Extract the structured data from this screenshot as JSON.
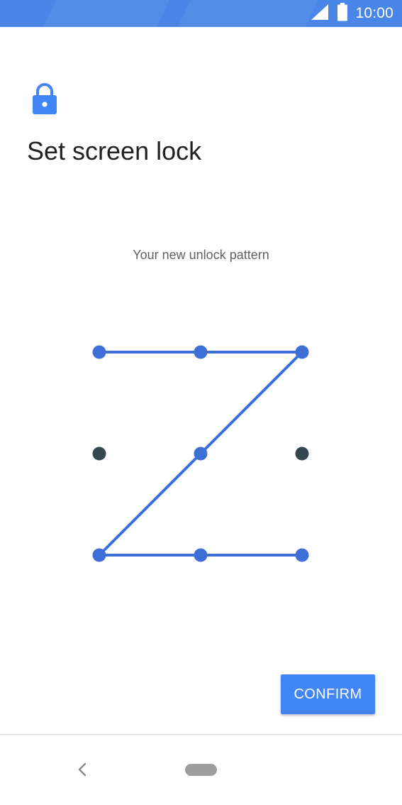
{
  "status_bar": {
    "time": "10:00",
    "signal_icon": "cellular-signal-icon",
    "battery_icon": "battery-full-icon"
  },
  "header": {
    "icon": "lock-icon",
    "title": "Set screen lock"
  },
  "pattern": {
    "instruction": "Your new unlock pattern",
    "grid": "3x3",
    "selected_sequence": [
      1,
      2,
      3,
      5,
      7,
      8,
      9
    ],
    "unselected_dots": [
      4,
      6
    ]
  },
  "actions": {
    "confirm_label": "CONFIRM"
  },
  "navigation": {
    "back_icon": "back-chevron-icon",
    "home_icon": "home-pill-icon"
  },
  "colors": {
    "status_bar": "#4a86e8",
    "accent": "#4285f4",
    "pattern_line": "#3d6fd6",
    "inactive_dot": "#37474f"
  }
}
